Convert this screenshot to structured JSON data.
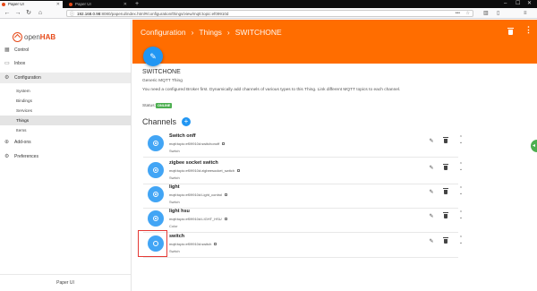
{
  "browser": {
    "tabs": [
      {
        "label": "Paper UI",
        "active": true
      },
      {
        "label": "Paper UI",
        "active": false
      }
    ],
    "url_host": "192.168.0.98",
    "url_rest": ":8080/paperui/index.html#/configuration/things/view/mqtt:topic:ef09910d"
  },
  "sidebar": {
    "logo_open": "open",
    "logo_hab": "HAB",
    "items": [
      {
        "label": "Control",
        "icon": "grid-icon"
      },
      {
        "label": "Inbox",
        "icon": "inbox-icon"
      },
      {
        "label": "Configuration",
        "icon": "gear-icon"
      }
    ],
    "sub_items": [
      {
        "label": "System"
      },
      {
        "label": "Bindings"
      },
      {
        "label": "Services"
      },
      {
        "label": "Things",
        "active": true
      },
      {
        "label": "Items"
      }
    ],
    "bottom_items": [
      {
        "label": "Add-ons",
        "icon": "add-icon"
      },
      {
        "label": "Preferences",
        "icon": "settings-icon"
      }
    ],
    "footer": "Paper UI"
  },
  "header": {
    "crumbs": [
      "Configuration",
      "Things",
      "SWITCHONE"
    ],
    "sep": "›"
  },
  "thing": {
    "title": "SWITCHONE",
    "type": "Generic MQTT Thing",
    "description": "You need a configured Broker first. Dynamically add channels of various types to this Thing. Link different MQTT topics to each channel.",
    "status_label": "Status:",
    "status": "ONLINE"
  },
  "channels_title": "Channels",
  "channels": [
    {
      "name": "Switch onff",
      "uid": "mqtt:topic:ef09910d:switchonoff",
      "type": "Switch"
    },
    {
      "name": "zigbee socket switch",
      "uid": "mqtt:topic:ef09910d:zigbeesocket_switch",
      "type": "Switch"
    },
    {
      "name": "light",
      "uid": "mqtt:topic:ef09910d:Light_control",
      "type": "Switch"
    },
    {
      "name": "light hsu",
      "uid": "mqtt:topic:ef09910d:LIGHT_HSU",
      "type": "Color"
    },
    {
      "name": "switch",
      "uid": "mqtt:topic:ef09910d:switch",
      "type": "Switch"
    }
  ],
  "colors": {
    "accent": "#ff6d00",
    "primary": "#2196f3",
    "online": "#4caf50",
    "highlight": "#e53935"
  }
}
